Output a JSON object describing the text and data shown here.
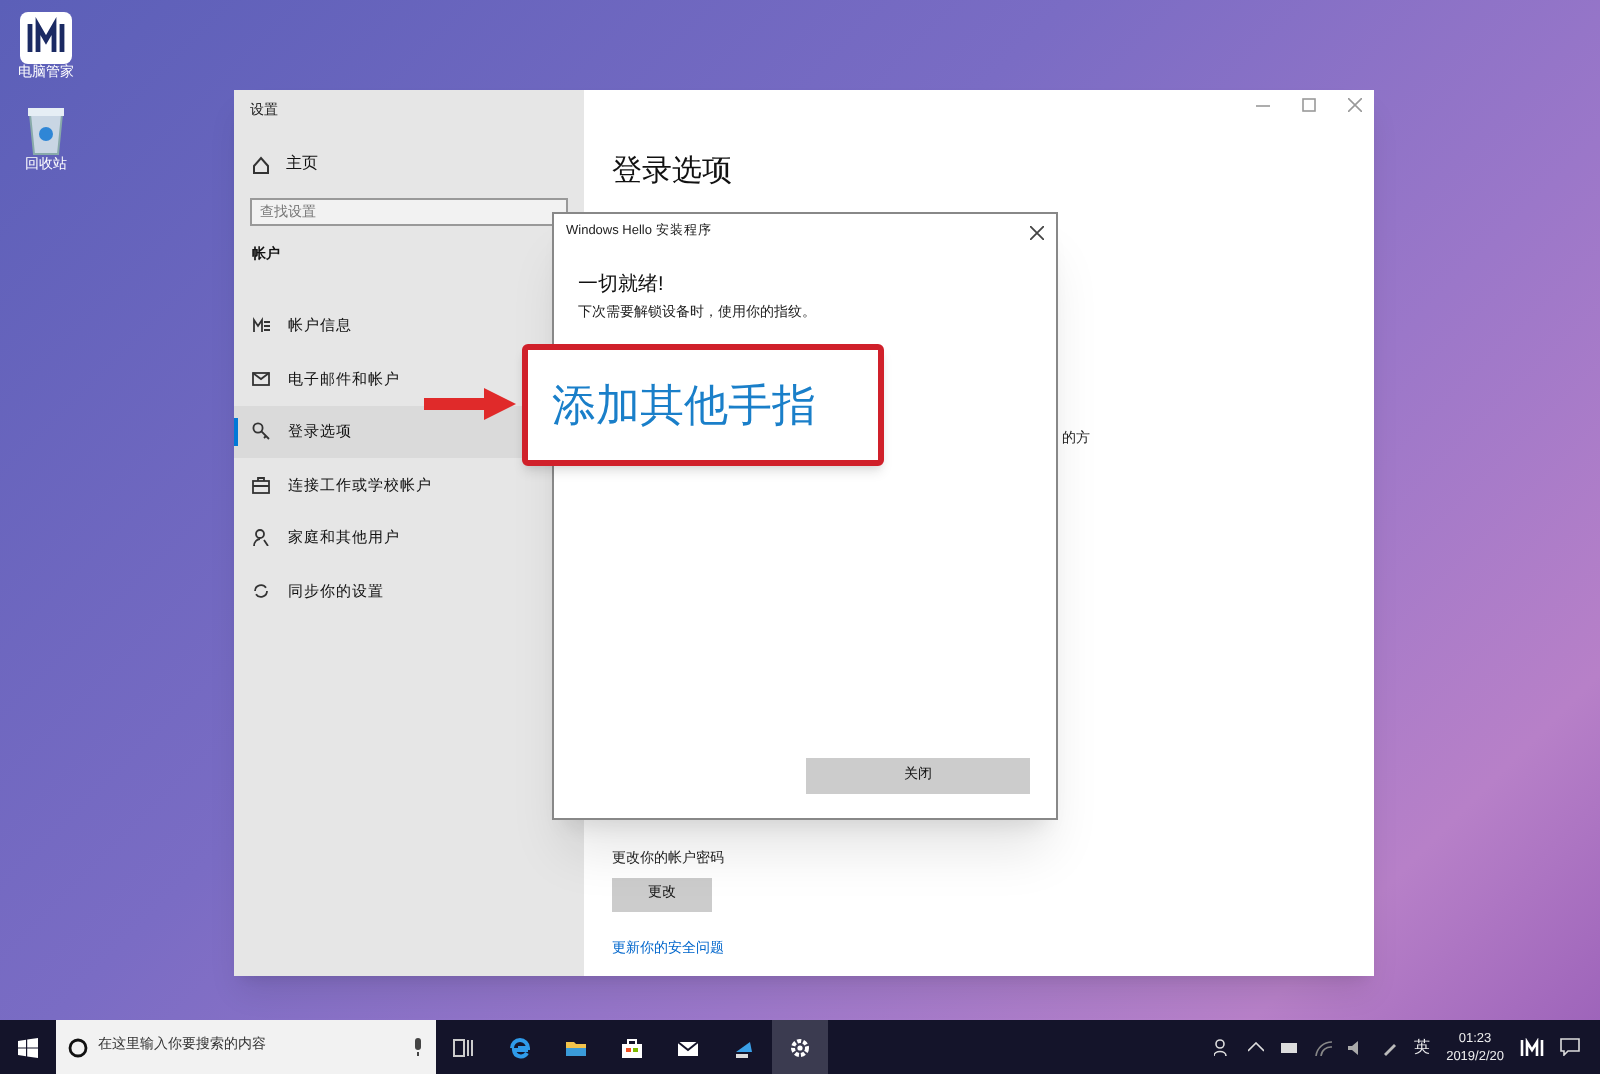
{
  "desktop_icons": [
    {
      "kind": "app",
      "label": "电脑管家"
    },
    {
      "kind": "recycle",
      "label": "回收站"
    }
  ],
  "settings_window": {
    "title": "设置",
    "home": "主页",
    "search": {
      "placeholder": "查找设置"
    },
    "section": "帐户",
    "nav_items": [
      {
        "kind": "info",
        "label": "帐户信息",
        "selected": false
      },
      {
        "kind": "mail",
        "label": "电子邮件和帐户",
        "selected": false
      },
      {
        "kind": "key",
        "label": "登录选项",
        "selected": true
      },
      {
        "kind": "work",
        "label": "连接工作或学校帐户",
        "selected": false
      },
      {
        "kind": "family",
        "label": "家庭和其他用户",
        "selected": false
      },
      {
        "kind": "sync",
        "label": "同步你的设置",
        "selected": false
      }
    ],
    "page_title": "登录选项",
    "partial_text": "的方",
    "password_description": "更改你的帐户密码",
    "change_button": "更改",
    "security_link": "更新你的安全问题"
  },
  "dialog": {
    "title": "Windows Hello 安装程序",
    "heading": "一切就绪!",
    "message": "下次需要解锁设备时，使用你的指纹。",
    "close_button": "关闭"
  },
  "callout": {
    "text": "添加其他手指"
  },
  "taskbar": {
    "search": {
      "placeholder": "在这里输入你要搜索的内容"
    },
    "apps": [
      {
        "kind": "taskview",
        "selected": false
      },
      {
        "kind": "edge",
        "selected": false
      },
      {
        "kind": "explorer",
        "selected": false
      },
      {
        "kind": "store",
        "selected": false
      },
      {
        "kind": "mail",
        "selected": false
      },
      {
        "kind": "remote",
        "selected": false
      },
      {
        "kind": "settings",
        "selected": true
      }
    ],
    "input_language": "英",
    "time": "01:23",
    "date": "2019/2/20"
  }
}
